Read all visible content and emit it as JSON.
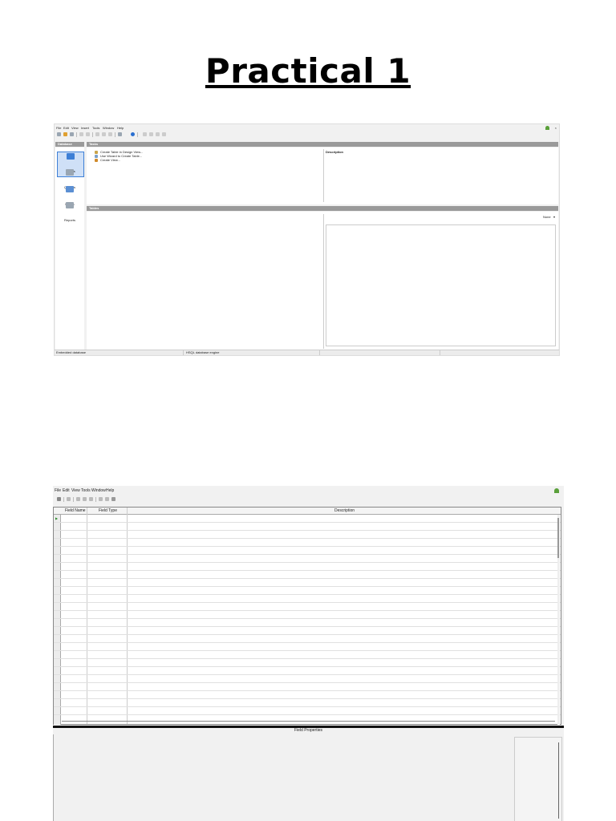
{
  "page": {
    "title": "Practical 1"
  },
  "screenshot1": {
    "menu": [
      "File",
      "Edit",
      "View",
      "Insert",
      "Tools",
      "Window",
      "Help"
    ],
    "sidebar": {
      "header": "Database",
      "items": [
        {
          "label": "Tables",
          "color": "#3d7fd6"
        },
        {
          "label": "Queries",
          "color": "#9aa6b2"
        },
        {
          "label": "Forms",
          "color": "#5b8fd3"
        },
        {
          "label": "Reports",
          "color": "#9aa6b2"
        }
      ]
    },
    "tasks": {
      "header": "Tasks",
      "items": [
        "Create Table in Design View...",
        "Use Wizard to Create Table...",
        "Create View..."
      ],
      "description_label": "Description"
    },
    "tables": {
      "header": "Tables",
      "preview_option": "None"
    },
    "status": [
      "Embedded database",
      "HSQL database engine"
    ]
  },
  "screenshot2": {
    "menu": [
      "File",
      "Edit",
      "View",
      "Tools",
      "Window",
      "Help"
    ],
    "columns": [
      "Field Name",
      "Field Type",
      "Description"
    ],
    "field_properties_label": "Field Properties"
  },
  "colors": {
    "panel_header": "#9a9a9a",
    "selection": "#3d7fd6",
    "accent_green": "#5aa03a"
  }
}
